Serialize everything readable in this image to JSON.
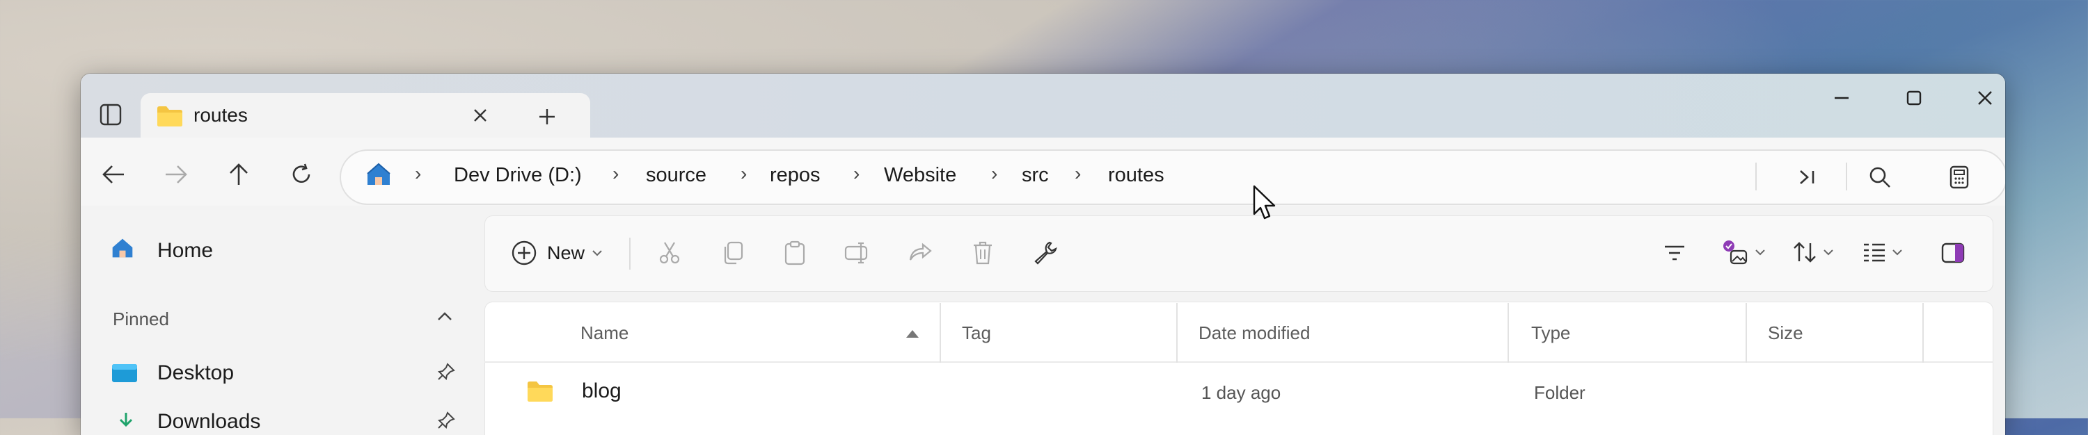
{
  "tab": {
    "title": "routes"
  },
  "breadcrumb": [
    "Dev Drive (D:)",
    "source",
    "repos",
    "Website",
    "src",
    "routes"
  ],
  "toolbar": {
    "new_label": "New"
  },
  "sidebar": {
    "home_label": "Home",
    "pinned_label": "Pinned",
    "items": [
      {
        "label": "Desktop"
      },
      {
        "label": "Downloads"
      }
    ]
  },
  "columns": [
    "Name",
    "Tag",
    "Date modified",
    "Type",
    "Size"
  ],
  "rows": [
    {
      "name": "blog",
      "tag": "",
      "date": "1 day ago",
      "type": "Folder",
      "size": ""
    }
  ],
  "icons": {
    "home": "home-icon",
    "folder": "folder-icon",
    "search": "search-icon",
    "new": "plus-circle-icon",
    "cut": "scissors-icon",
    "copy": "copy-icon"
  },
  "colors": {
    "accent": "#0f6cbd",
    "folder": "#f4c542",
    "home_blue": "#2f80d1"
  }
}
